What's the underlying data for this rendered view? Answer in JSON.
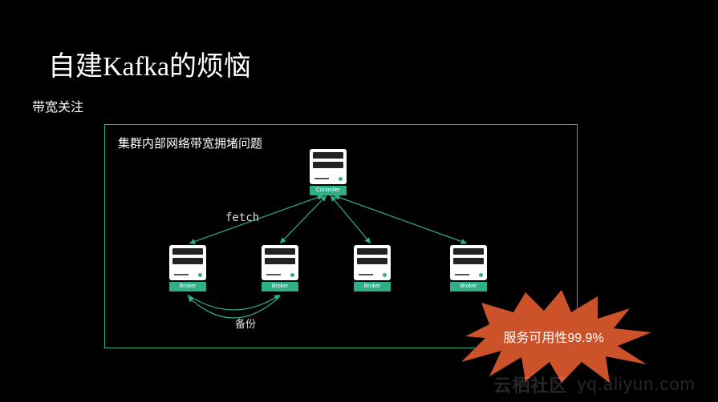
{
  "title": "自建Kafka的烦恼",
  "subtitle": "带宽关注",
  "diagram": {
    "box_title": "集群内部网络带宽拥堵问题",
    "fetch_label": "fetch",
    "backup_label": "备份",
    "nodes": {
      "controller": "Controller",
      "b1": "Broker",
      "b2": "Broker",
      "b3": "Broker",
      "b4": "Broker"
    }
  },
  "badge": {
    "text": "服务可用性99.9%"
  },
  "footer": {
    "brand": "云栖社区",
    "url": "yq.aliyun.com"
  },
  "chart_data": {
    "type": "tree",
    "title": "集群内部网络带宽拥堵问题",
    "root": {
      "label": "Controller"
    },
    "children": [
      {
        "label": "Broker"
      },
      {
        "label": "Broker"
      },
      {
        "label": "Broker"
      },
      {
        "label": "Broker"
      }
    ],
    "edges": [
      {
        "from": "Controller",
        "to": "Broker1",
        "label": "fetch",
        "bidirectional": true
      },
      {
        "from": "Controller",
        "to": "Broker2",
        "bidirectional": true
      },
      {
        "from": "Controller",
        "to": "Broker3",
        "bidirectional": true
      },
      {
        "from": "Controller",
        "to": "Broker4",
        "bidirectional": true
      },
      {
        "from": "Broker1",
        "to": "Broker2",
        "label": "备份",
        "bidirectional": true
      }
    ],
    "annotation": "服务可用性99.9%"
  }
}
